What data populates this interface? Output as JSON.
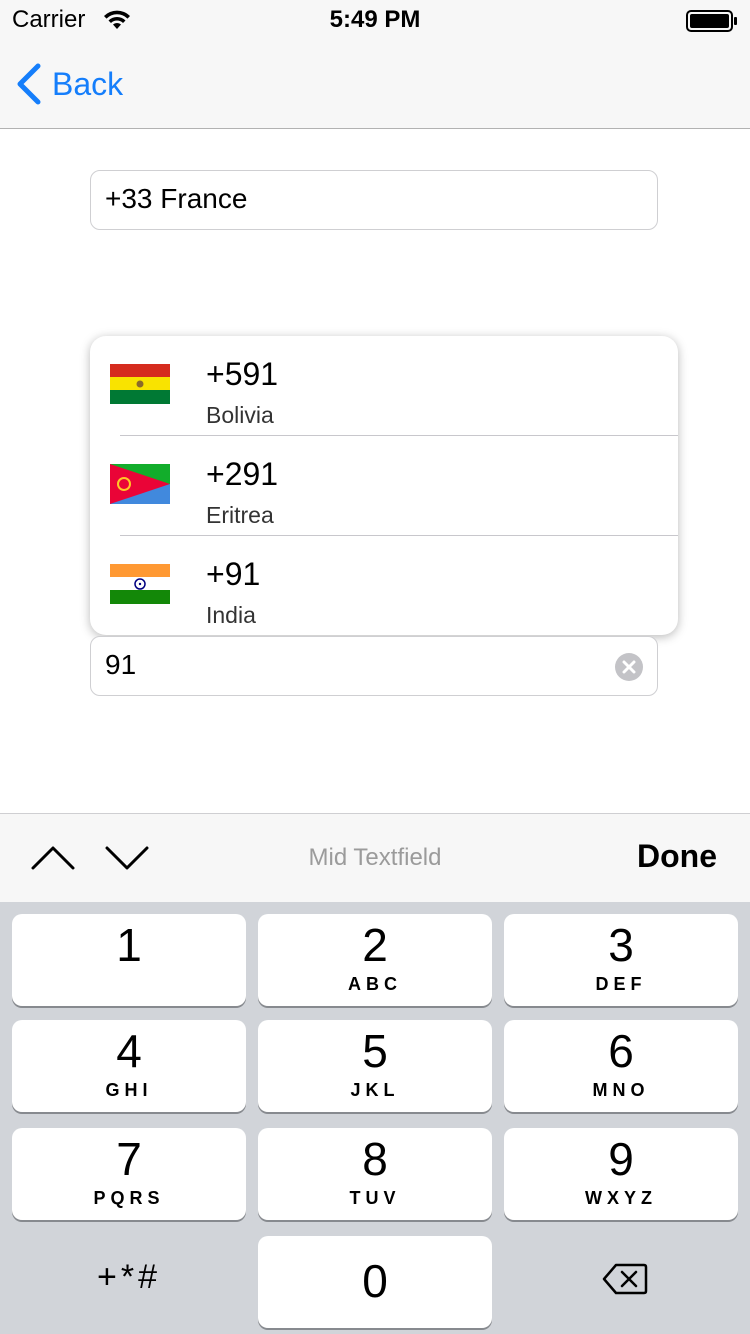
{
  "status_bar": {
    "carrier": "Carrier",
    "time": "5:49 PM"
  },
  "nav": {
    "back_label": "Back",
    "tint_color": "#157efb"
  },
  "top_field": {
    "value": "+33 France"
  },
  "dropdown": {
    "items": [
      {
        "code": "+591",
        "country": "Bolivia",
        "flag_icon": "bolivia-flag-icon"
      },
      {
        "code": "+291",
        "country": "Eritrea",
        "flag_icon": "eritrea-flag-icon"
      },
      {
        "code": "+91",
        "country": "India",
        "flag_icon": "india-flag-icon"
      }
    ]
  },
  "mid_field": {
    "value": "91"
  },
  "toolbar": {
    "title": "Mid Textfield",
    "done_label": "Done"
  },
  "keypad": {
    "keys": [
      {
        "digit": "1",
        "letters": ""
      },
      {
        "digit": "2",
        "letters": "ABC"
      },
      {
        "digit": "3",
        "letters": "DEF"
      },
      {
        "digit": "4",
        "letters": "GHI"
      },
      {
        "digit": "5",
        "letters": "JKL"
      },
      {
        "digit": "6",
        "letters": "MNO"
      },
      {
        "digit": "7",
        "letters": "PQRS"
      },
      {
        "digit": "8",
        "letters": "TUV"
      },
      {
        "digit": "9",
        "letters": "WXYZ"
      },
      {
        "digit": "0",
        "letters": ""
      }
    ],
    "symbols_label": "+*#"
  }
}
